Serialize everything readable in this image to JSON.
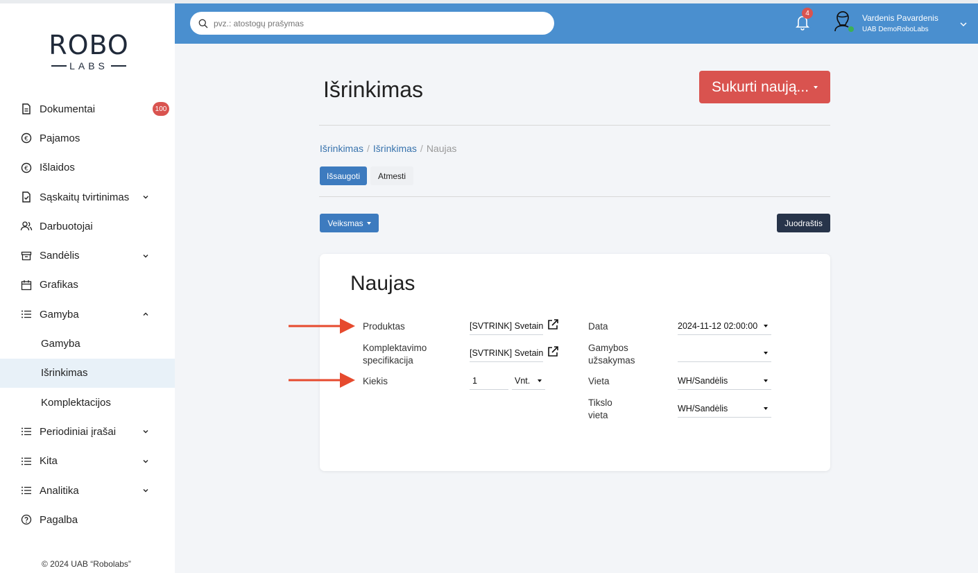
{
  "sidebar": {
    "logo_top": "ROBO",
    "logo_bottom": "LABS",
    "items": [
      {
        "label": "Dokumentai",
        "icon": "document-icon",
        "badge": "100"
      },
      {
        "label": "Pajamos",
        "icon": "income-icon"
      },
      {
        "label": "Išlaidos",
        "icon": "expense-icon"
      },
      {
        "label": "Sąskaitų tvirtinimas",
        "icon": "approval-icon",
        "chevron": "down"
      },
      {
        "label": "Darbuotojai",
        "icon": "users-icon"
      },
      {
        "label": "Sandėlis",
        "icon": "warehouse-icon",
        "chevron": "down"
      },
      {
        "label": "Grafikas",
        "icon": "calendar-icon"
      },
      {
        "label": "Gamyba",
        "icon": "list-icon",
        "chevron": "up"
      },
      {
        "label": "Gamyba",
        "sub": true
      },
      {
        "label": "Išrinkimas",
        "sub": true,
        "active": true
      },
      {
        "label": "Komplektacijos",
        "sub": true
      },
      {
        "label": "Periodiniai įrašai",
        "icon": "list-icon",
        "chevron": "down"
      },
      {
        "label": "Kita",
        "icon": "list-icon",
        "chevron": "down"
      },
      {
        "label": "Analitika",
        "icon": "list-icon",
        "chevron": "down"
      },
      {
        "label": "Pagalba",
        "icon": "help-icon"
      }
    ],
    "footer": "© 2024 UAB “Robolabs”"
  },
  "header": {
    "search_placeholder": "pvz.: atostogų prašymas",
    "notification_count": "4",
    "user_name": "Vardenis Pavardenis",
    "company": "UAB DemoRoboLabs",
    "online_color": "#3cb054"
  },
  "main": {
    "title": "Išrinkimas",
    "create_label": "Sukurti naują...",
    "breadcrumb": [
      "Išrinkimas",
      "Išrinkimas",
      "Naujas"
    ],
    "save_label": "Išsaugoti",
    "discard_label": "Atmesti",
    "action_label": "Veiksmas",
    "status_label": "Juodraštis"
  },
  "form": {
    "title": "Naujas",
    "product_label": "Produktas",
    "product_value": "[SVTRINK] Svetainės",
    "spec_label_1": "Komplektavimo",
    "spec_label_2": "specifikacija",
    "spec_value": "[SVTRINK] Svetainės",
    "qty_label": "Kiekis",
    "qty_value": "1",
    "uom_value": "Vnt.",
    "date_label": "Data",
    "date_value": "2024-11-12 02:00:00",
    "order_label_1": "Gamybos",
    "order_label_2": "užsakymas",
    "order_value": "",
    "location_label": "Vieta",
    "location_value": "WH/Sandėlis",
    "dest_label_1": "Tikslo",
    "dest_label_2": "vieta",
    "dest_value": "WH/Sandėlis"
  },
  "colors": {
    "header": "#4a8fcf",
    "primary": "#3d7bbf",
    "danger": "#d9534f",
    "dark": "#27344a",
    "annotation_arrow": "#e64a2e"
  }
}
